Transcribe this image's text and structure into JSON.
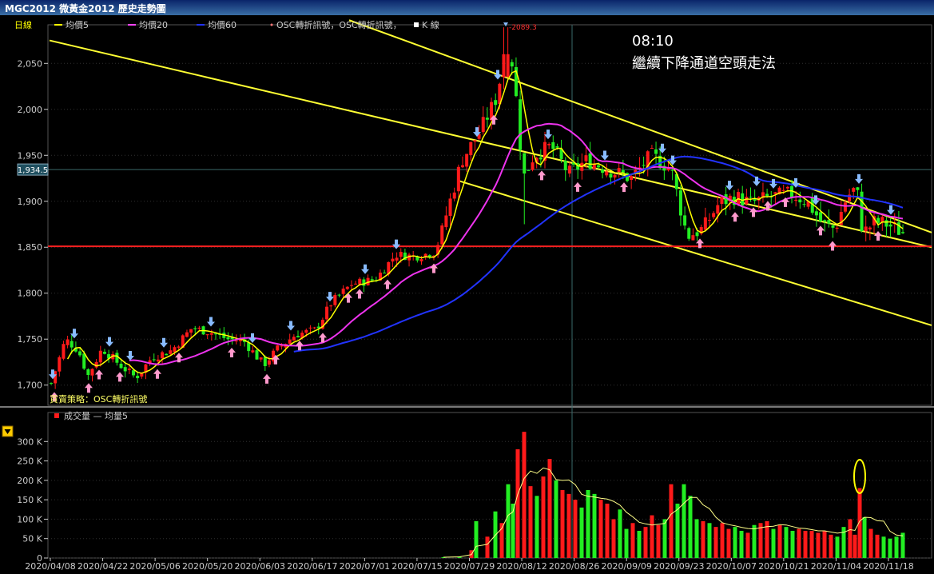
{
  "window": {
    "title": "MGC2012 微黃金2012  歷史走勢圖"
  },
  "price_legend": [
    {
      "label": "日線",
      "color": "#ffff00"
    },
    {
      "label": "均價5",
      "color": "#ffff00"
    },
    {
      "label": "均價20",
      "color": "#ff44ff"
    },
    {
      "label": "均價60",
      "color": "#2233ff"
    },
    {
      "label": "OSC轉折訊號，OSC轉折訊號，",
      "color": "#ff7777"
    },
    {
      "label": "K 線",
      "color": "#ffffff"
    }
  ],
  "annotation": {
    "time": "08:10",
    "note": "繼續下降通道空頭走法"
  },
  "strategy_label": "買賣策略：OSC轉折訊號",
  "volume_legend": {
    "label": "成交量 — 均量5"
  },
  "colors": {
    "up": "#ff1a1a",
    "down": "#22ee22",
    "ma5": "#ffff00",
    "ma20": "#ee33ee",
    "ma60": "#2233ff",
    "support": "#ff2020",
    "channel": "#ffff33",
    "buy_signal": "#ff99cc",
    "sell_signal": "#88bbff",
    "axis": "#cccccc",
    "grid": "#303030"
  },
  "chart_data": {
    "type": "candlestick",
    "x_ticks": [
      "2020/04/08",
      "2020/04/22",
      "2020/05/06",
      "2020/05/20",
      "2020/06/03",
      "2020/06/17",
      "2020/07/01",
      "2020/07/15",
      "2020/07/29",
      "2020/08/12",
      "2020/08/26",
      "2020/09/09",
      "2020/09/23",
      "2020/10/07",
      "2020/10/21",
      "2020/11/04",
      "2020/11/18"
    ],
    "price_axis": {
      "ticks": [
        "2,050",
        "2,000",
        "1,950",
        "1,900",
        "1,850",
        "1,800",
        "1,750",
        "1,700"
      ],
      "min": 1678,
      "max": 2092
    },
    "current_price_label": "1,934.5",
    "current_price": 1934.5,
    "high_label": "2089.3",
    "high_value": 2089.3,
    "support_level": 1851,
    "volume_axis": {
      "ticks": [
        "300 K",
        "250 K",
        "200 K",
        "150 K",
        "100 K",
        "50 K",
        "0"
      ],
      "max": 350
    },
    "ma5_volume_peak": 210
  }
}
